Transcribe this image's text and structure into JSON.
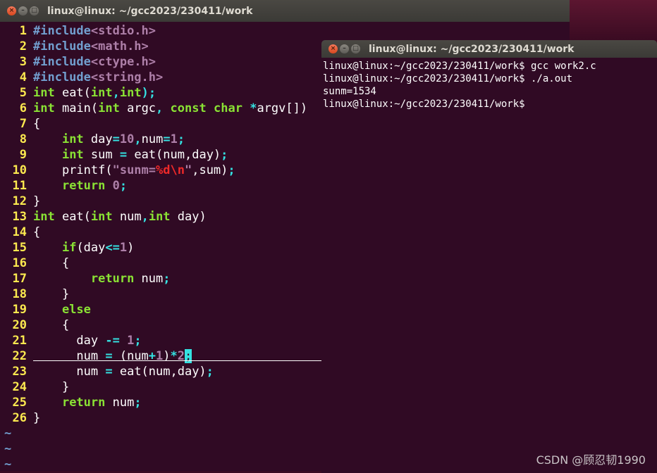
{
  "vim_window": {
    "title": "linux@linux: ~/gcc2023/230411/work",
    "buttons": [
      "×",
      "–",
      "□"
    ],
    "lines": [
      [
        {
          "t": "#include",
          "c": "pp"
        },
        {
          "t": "<stdio.h>",
          "c": "str"
        }
      ],
      [
        {
          "t": "#include",
          "c": "pp"
        },
        {
          "t": "<math.h>",
          "c": "str"
        }
      ],
      [
        {
          "t": "#include",
          "c": "pp"
        },
        {
          "t": "<ctype.h>",
          "c": "str"
        }
      ],
      [
        {
          "t": "#include",
          "c": "pp"
        },
        {
          "t": "<string.h>",
          "c": "str"
        }
      ],
      [
        {
          "t": "int",
          "c": "kw"
        },
        {
          "t": " eat(",
          "c": ""
        },
        {
          "t": "int",
          "c": "kw"
        },
        {
          "t": ",",
          "c": "op"
        },
        {
          "t": "int",
          "c": "kw"
        },
        {
          "t": ");",
          "c": "op"
        }
      ],
      [
        {
          "t": "int",
          "c": "kw"
        },
        {
          "t": " main(",
          "c": ""
        },
        {
          "t": "int",
          "c": "kw"
        },
        {
          "t": " argc",
          "c": ""
        },
        {
          "t": ",",
          "c": "op"
        },
        {
          "t": " ",
          "c": ""
        },
        {
          "t": "const",
          "c": "kw"
        },
        {
          "t": " ",
          "c": ""
        },
        {
          "t": "char",
          "c": "kw"
        },
        {
          "t": " ",
          "c": ""
        },
        {
          "t": "*",
          "c": "op"
        },
        {
          "t": "argv[])",
          "c": ""
        }
      ],
      [
        {
          "t": "{",
          "c": ""
        }
      ],
      [
        {
          "t": "    ",
          "c": ""
        },
        {
          "t": "int",
          "c": "kw"
        },
        {
          "t": " day",
          "c": ""
        },
        {
          "t": "=",
          "c": "op"
        },
        {
          "t": "10",
          "c": "num"
        },
        {
          "t": ",",
          "c": "op"
        },
        {
          "t": "num",
          "c": ""
        },
        {
          "t": "=",
          "c": "op"
        },
        {
          "t": "1",
          "c": "num"
        },
        {
          "t": ";",
          "c": "op"
        }
      ],
      [
        {
          "t": "    ",
          "c": ""
        },
        {
          "t": "int",
          "c": "kw"
        },
        {
          "t": " sum ",
          "c": ""
        },
        {
          "t": "=",
          "c": "op"
        },
        {
          "t": " eat(num,day)",
          "c": ""
        },
        {
          "t": ";",
          "c": "op"
        }
      ],
      [
        {
          "t": "    printf(",
          "c": ""
        },
        {
          "t": "\"sunm=",
          "c": "str"
        },
        {
          "t": "%d\\n",
          "c": "esc"
        },
        {
          "t": "\"",
          "c": "str"
        },
        {
          "t": ",sum)",
          "c": ""
        },
        {
          "t": ";",
          "c": "op"
        }
      ],
      [
        {
          "t": "    ",
          "c": ""
        },
        {
          "t": "return",
          "c": "kw"
        },
        {
          "t": " ",
          "c": ""
        },
        {
          "t": "0",
          "c": "num"
        },
        {
          "t": ";",
          "c": "op"
        }
      ],
      [
        {
          "t": "}",
          "c": ""
        }
      ],
      [
        {
          "t": "int",
          "c": "kw"
        },
        {
          "t": " eat(",
          "c": ""
        },
        {
          "t": "int",
          "c": "kw"
        },
        {
          "t": " num",
          "c": ""
        },
        {
          "t": ",",
          "c": "op"
        },
        {
          "t": "int",
          "c": "kw"
        },
        {
          "t": " day)",
          "c": ""
        }
      ],
      [
        {
          "t": "{",
          "c": ""
        }
      ],
      [
        {
          "t": "    ",
          "c": ""
        },
        {
          "t": "if",
          "c": "kw"
        },
        {
          "t": "(day",
          "c": ""
        },
        {
          "t": "<=",
          "c": "op"
        },
        {
          "t": "1",
          "c": "num"
        },
        {
          "t": ")",
          "c": ""
        }
      ],
      [
        {
          "t": "    {",
          "c": ""
        }
      ],
      [
        {
          "t": "        ",
          "c": ""
        },
        {
          "t": "return",
          "c": "kw"
        },
        {
          "t": " num",
          "c": ""
        },
        {
          "t": ";",
          "c": "op"
        }
      ],
      [
        {
          "t": "    }",
          "c": ""
        }
      ],
      [
        {
          "t": "    ",
          "c": ""
        },
        {
          "t": "else",
          "c": "kw"
        }
      ],
      [
        {
          "t": "    {",
          "c": ""
        }
      ],
      [
        {
          "t": "      day ",
          "c": ""
        },
        {
          "t": "-=",
          "c": "op"
        },
        {
          "t": " ",
          "c": ""
        },
        {
          "t": "1",
          "c": "num"
        },
        {
          "t": ";",
          "c": "op"
        }
      ],
      [
        {
          "t": "      num ",
          "c": ""
        },
        {
          "t": "=",
          "c": "op"
        },
        {
          "t": " (num",
          "c": ""
        },
        {
          "t": "+",
          "c": "op"
        },
        {
          "t": "1",
          "c": "num"
        },
        {
          "t": ")",
          "c": ""
        },
        {
          "t": "*",
          "c": "op"
        },
        {
          "t": "2",
          "c": "num"
        },
        {
          "t": ";",
          "c": "cursor"
        }
      ],
      [
        {
          "t": "      num ",
          "c": ""
        },
        {
          "t": "=",
          "c": "op"
        },
        {
          "t": " eat(num,day)",
          "c": ""
        },
        {
          "t": ";",
          "c": "op"
        }
      ],
      [
        {
          "t": "    }",
          "c": ""
        }
      ],
      [
        {
          "t": "    ",
          "c": ""
        },
        {
          "t": "return",
          "c": "kw"
        },
        {
          "t": " num",
          "c": ""
        },
        {
          "t": ";",
          "c": "op"
        }
      ],
      [
        {
          "t": "}",
          "c": ""
        }
      ]
    ],
    "tilde": "~"
  },
  "terminal_window": {
    "title": "linux@linux: ~/gcc2023/230411/work",
    "buttons": [
      "×",
      "–",
      "□"
    ],
    "lines": [
      "linux@linux:~/gcc2023/230411/work$ gcc work2.c",
      "linux@linux:~/gcc2023/230411/work$ ./a.out",
      "sunm=1534",
      "linux@linux:~/gcc2023/230411/work$"
    ]
  },
  "watermark": "CSDN @顾忍韧1990",
  "colors": {
    "background": "#300a24",
    "line_number": "#fce94f",
    "keyword": "#8ae234",
    "preprocessor": "#729fcf",
    "constant": "#ad7fa8",
    "operator": "#34e2e2",
    "special": "#ef2929"
  }
}
